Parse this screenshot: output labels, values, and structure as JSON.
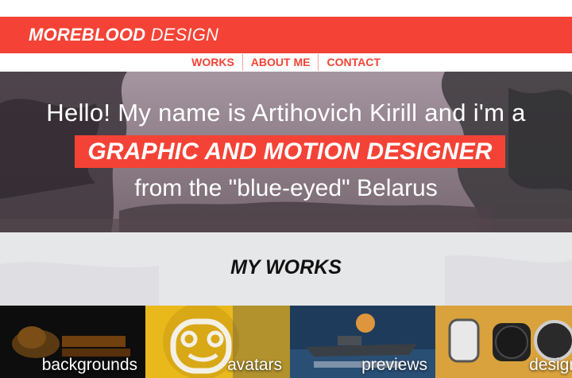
{
  "header": {
    "logo_bold": "MOREBLOOD",
    "logo_light": "DESIGN"
  },
  "nav": {
    "items": [
      {
        "label": "WORKS"
      },
      {
        "label": "ABOUT ME"
      },
      {
        "label": "CONTACT"
      }
    ]
  },
  "hero": {
    "line1": "Hello! My name is Artihovich Kirill and i'm a",
    "highlight": "GRAPHIC AND MOTION DESIGNER",
    "line3": "from the \"blue-eyed\" Belarus"
  },
  "works": {
    "title": "MY WORKS",
    "tiles": [
      {
        "label": "backgrounds"
      },
      {
        "label": "avatars"
      },
      {
        "label": "previews"
      },
      {
        "label": "design"
      }
    ]
  },
  "colors": {
    "accent": "#f44336",
    "band": "#e6e7e9"
  }
}
